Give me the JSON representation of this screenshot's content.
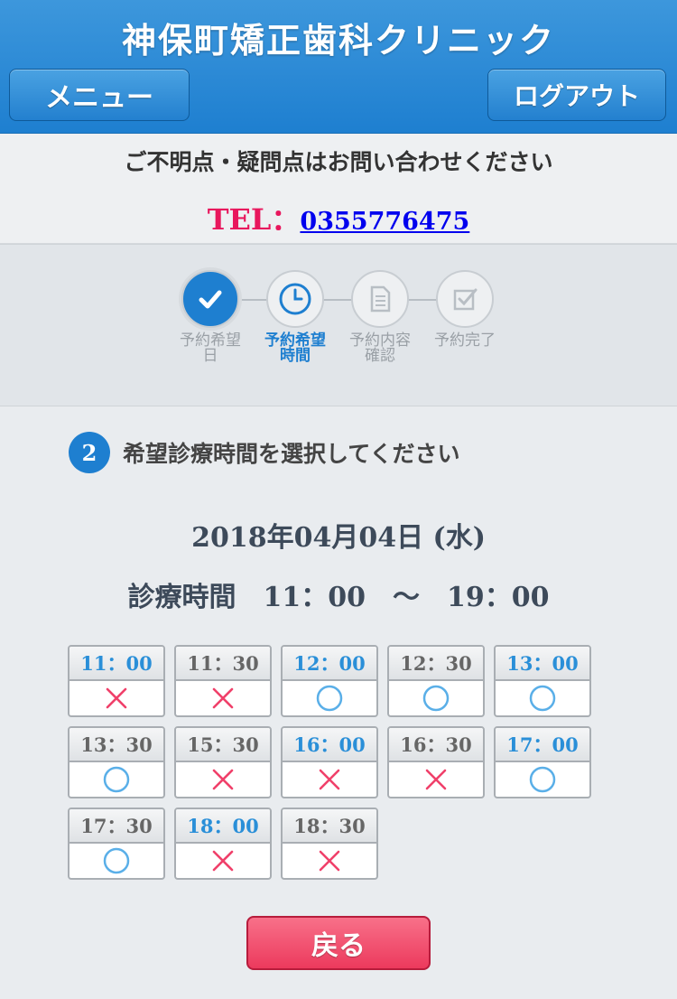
{
  "header": {
    "title": "神保町矯正歯科クリニック",
    "menu_label": "メニュー",
    "logout_label": "ログアウト"
  },
  "contact": {
    "message": "ご不明点・疑問点はお問い合わせください",
    "tel_label": "TEL：",
    "tel_number": "0355776475"
  },
  "steps": [
    {
      "line1": "予約希望",
      "line2": "日",
      "state": "done",
      "icon": "check-icon"
    },
    {
      "line1": "予約希望",
      "line2": "時間",
      "state": "current",
      "icon": "clock-icon"
    },
    {
      "line1": "予約内容",
      "line2": "確認",
      "state": "pending",
      "icon": "document-icon"
    },
    {
      "line1": "予約完了",
      "line2": "",
      "state": "pending",
      "icon": "checkbox-icon"
    }
  ],
  "section": {
    "number": "2",
    "title": "希望診療時間を選択してください"
  },
  "date": "2018年04月04日 (水)",
  "hours": "診療時間　11：00　～　19：00",
  "slots": [
    {
      "time": "11：00",
      "available": false,
      "highlight": true
    },
    {
      "time": "11：30",
      "available": false,
      "highlight": false
    },
    {
      "time": "12：00",
      "available": true,
      "highlight": true
    },
    {
      "time": "12：30",
      "available": true,
      "highlight": false
    },
    {
      "time": "13：00",
      "available": true,
      "highlight": true
    },
    {
      "time": "13：30",
      "available": true,
      "highlight": false
    },
    {
      "time": "15：30",
      "available": false,
      "highlight": false
    },
    {
      "time": "16：00",
      "available": false,
      "highlight": true
    },
    {
      "time": "16：30",
      "available": false,
      "highlight": false
    },
    {
      "time": "17：00",
      "available": true,
      "highlight": true
    },
    {
      "time": "17：30",
      "available": true,
      "highlight": false
    },
    {
      "time": "18：00",
      "available": false,
      "highlight": true
    },
    {
      "time": "18：30",
      "available": false,
      "highlight": false
    }
  ],
  "back_label": "戻る",
  "colors": {
    "primary": "#1e7fd0",
    "tel": "#e8175d",
    "available": "#5aafe8",
    "unavailable": "#f0406a",
    "back": "#ec3a5d"
  }
}
